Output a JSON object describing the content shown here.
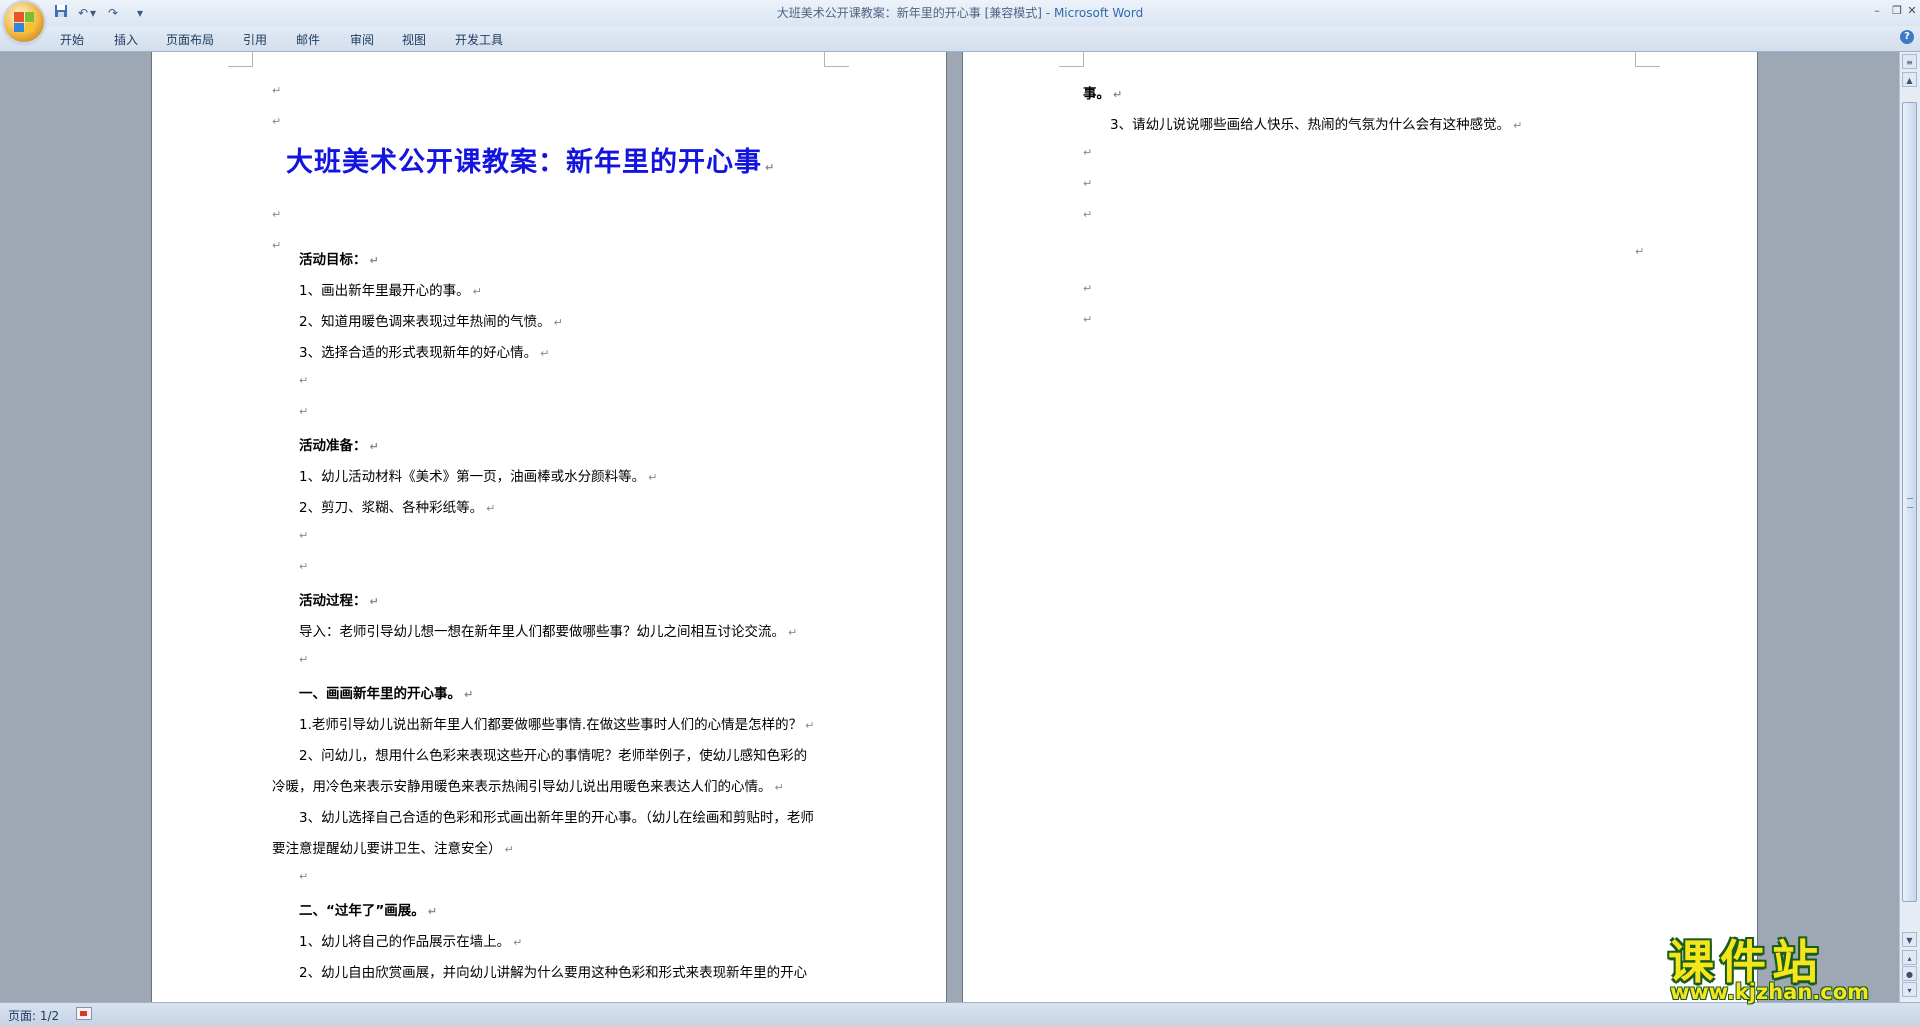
{
  "window": {
    "title": "大班美术公开课教案：新年里的开心事 [兼容模式]",
    "title_sep": " - ",
    "app_name": "Microsoft Word"
  },
  "quick_access": {
    "save_icon": "save-icon",
    "undo_icon": "undo-icon",
    "redo_icon": "redo-icon",
    "customize_icon": "chevron-down-icon"
  },
  "ribbon": {
    "tabs": [
      "开始",
      "插入",
      "页面布局",
      "引用",
      "邮件",
      "审阅",
      "视图",
      "开发工具"
    ]
  },
  "page1": {
    "title": "大班美术公开课教案：新年里的开心事",
    "goal_heading": "活动目标：",
    "goals": [
      "1、画出新年里最开心的事。",
      "2、知道用暖色调来表现过年热闹的气愤。",
      "3、选择合适的形式表现新年的好心情。"
    ],
    "prep_heading": "活动准备：",
    "preps": [
      "1、幼儿活动材料《美术》第一页，油画棒或水分颜料等。",
      "2、剪刀、浆糊、各种彩纸等。"
    ],
    "process_heading": "活动过程：",
    "intro": "导入：老师引导幼儿想一想在新年里人们都要做哪些事？幼儿之间相互讨论交流。",
    "section1_heading": "一、画画新年里的开心事。",
    "s1_item1": "1.老师引导幼儿说出新年里人们都要做哪些事情.在做这些事时人们的心情是怎样的？",
    "s1_item2_line1": "2、问幼儿，想用什么色彩来表现这些开心的事情呢？老师举例子，使幼儿感知色彩的",
    "s1_item2_line2": "冷暖，用冷色来表示安静用暖色来表示热闹引导幼儿说出用暖色来表达人们的心情。",
    "s1_item3_line1": "3、幼儿选择自己合适的色彩和形式画出新年里的开心事。（幼儿在绘画和剪贴时，老师",
    "s1_item3_line2": "要注意提醒幼儿要讲卫生、注意安全）",
    "section2_heading": "二、“过年了”画展。",
    "s2_item1": "1、幼儿将自己的作品展示在墙上。",
    "s2_item2": "2、幼儿自由欣赏画展，并向幼儿讲解为什么要用这种色彩和形式来表现新年里的开心"
  },
  "page2": {
    "line1": "事。",
    "line2": "3、请幼儿说说哪些画给人快乐、热闹的气氛为什么会有这种感觉。"
  },
  "paragraph_mark": "↵",
  "statusbar": {
    "page_label": "页面: 1/2"
  },
  "watermark": {
    "main": "课件站",
    "url": "www.kjzhan.com"
  },
  "colors": {
    "title_blue": "#1414e0",
    "watermark_yellow": "#f5e51c",
    "watermark_outline": "#1a5c1a"
  }
}
